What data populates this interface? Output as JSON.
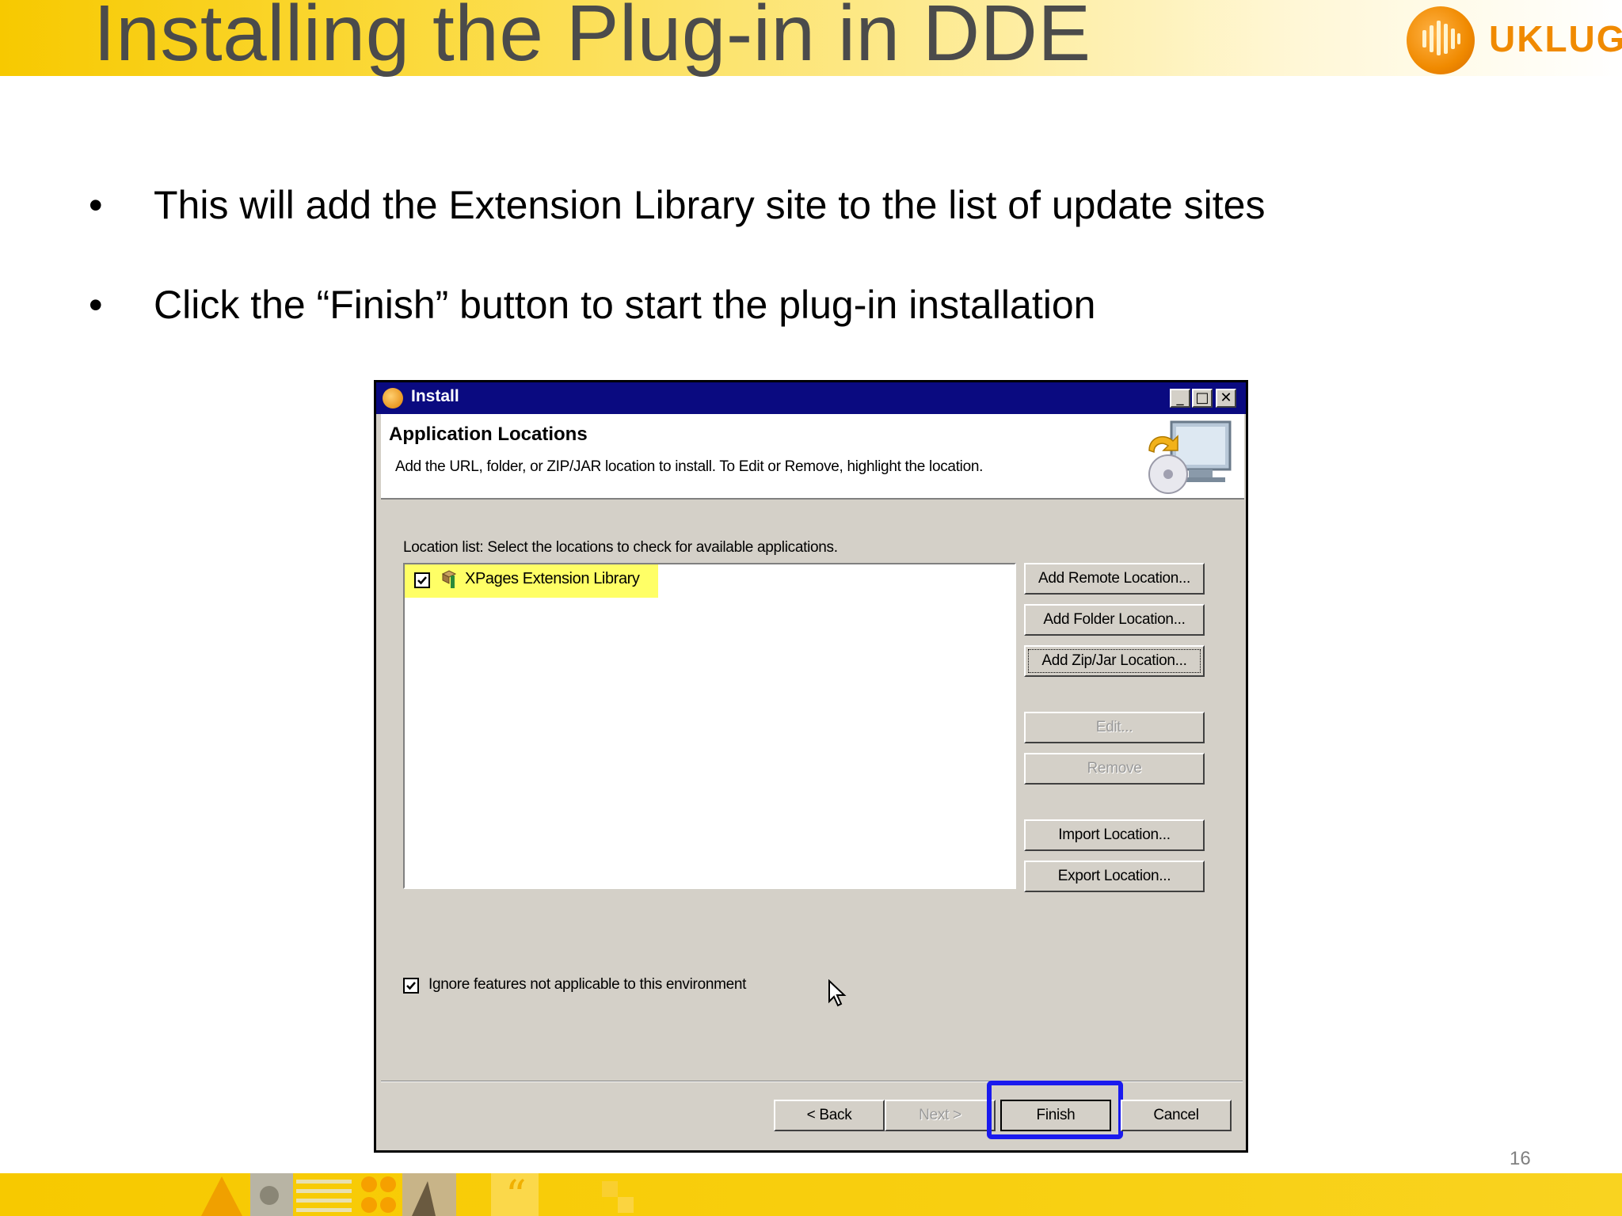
{
  "slide": {
    "title": "Installing the Plug-in in DDE",
    "logo_text": "UKLUG",
    "bullets": [
      "This will add the Extension Library site to the list of update sites",
      "Click the “Finish” button to start the plug-in installation"
    ],
    "page_number": "16"
  },
  "dialog": {
    "window_title": "Install",
    "window_controls": [
      "minimize",
      "maximize",
      "close"
    ],
    "banner_title": "Application Locations",
    "banner_description": "Add the URL, folder, or ZIP/JAR location to install. To Edit or Remove, highlight the location.",
    "location_list_label": "Location list: Select the locations to check for available applications.",
    "locations": [
      {
        "label": "XPages Extension Library",
        "checked": true
      }
    ],
    "side_buttons": {
      "add_remote": "Add Remote Location...",
      "add_folder": "Add Folder Location...",
      "add_zip": "Add Zip/Jar Location...",
      "edit": "Edit...",
      "remove": "Remove",
      "import": "Import Location...",
      "export": "Export Location..."
    },
    "ignore_checkbox": {
      "label": "Ignore features not applicable to this environment",
      "checked": true
    },
    "footer_buttons": {
      "back": "< Back",
      "next": "Next >",
      "finish": "Finish",
      "cancel": "Cancel"
    }
  },
  "colors": {
    "header_yellow": "#f7c900",
    "title_bar": "#0a0a80",
    "dialog_face": "#d4d0c8",
    "row_highlight": "#ffff66",
    "finish_highlight": "#1a1aee",
    "logo_orange": "#f08a00"
  }
}
